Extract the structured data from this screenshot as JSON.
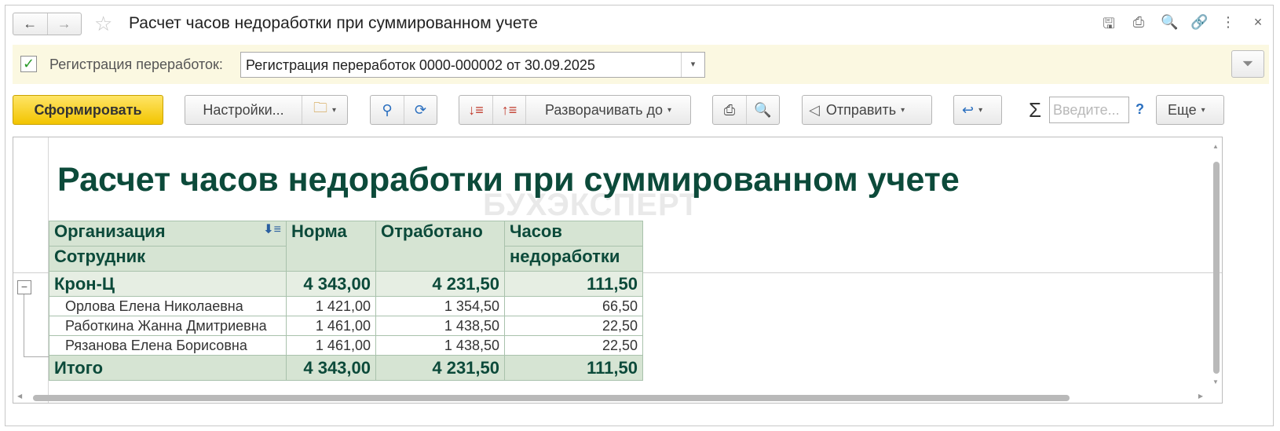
{
  "window": {
    "title": "Расчет часов недоработки при суммированном учете",
    "back_icon": "←",
    "forward_icon": "→",
    "star_icon": "☆",
    "actions": [
      "save-icon",
      "print-icon",
      "preview-icon",
      "link-icon",
      "more-vert-icon",
      "close-icon"
    ],
    "action_glyphs": [
      "🖫",
      "⎙",
      "🔍",
      "🔗",
      "⋮",
      "×"
    ]
  },
  "filter": {
    "checked": true,
    "check_glyph": "✓",
    "label": "Регистрация переработок:",
    "value": "Регистрация переработок 0000-000002 от 30.09.2025",
    "dropdown_glyph": "▾",
    "funnel_glyph": "⏷"
  },
  "toolbar": {
    "generate": "Сформировать",
    "settings": "Настройки...",
    "expand_to": "Разворачивать до",
    "send": "Отправить",
    "search_placeholder": "Введите...",
    "help": "?",
    "more": "Еще",
    "sigma": "Σ",
    "caret": "▾"
  },
  "report": {
    "title": "Расчет часов недоработки при суммированном учете",
    "watermark": "БУХЭКСПЕРТ",
    "headers": {
      "org": "Организация",
      "employee": "Сотрудник",
      "norm": "Норма",
      "worked": "Отработано",
      "shortfall_1": "Часов",
      "shortfall_2": "недоработки"
    },
    "group": {
      "name": "Крон-Ц",
      "norm": "4 343,00",
      "worked": "4 231,50",
      "shortfall": "111,50"
    },
    "rows": [
      {
        "name": "Орлова Елена Николаевна",
        "norm": "1 421,00",
        "worked": "1 354,50",
        "shortfall": "66,50"
      },
      {
        "name": "Работкина Жанна Дмитриевна",
        "norm": "1 461,00",
        "worked": "1 438,50",
        "shortfall": "22,50"
      },
      {
        "name": "Рязанова Елена Борисовна",
        "norm": "1 461,00",
        "worked": "1 438,50",
        "shortfall": "22,50"
      }
    ],
    "total": {
      "label": "Итого",
      "norm": "4 343,00",
      "worked": "4 231,50",
      "shortfall": "111,50"
    },
    "collapse_glyph": "−"
  }
}
